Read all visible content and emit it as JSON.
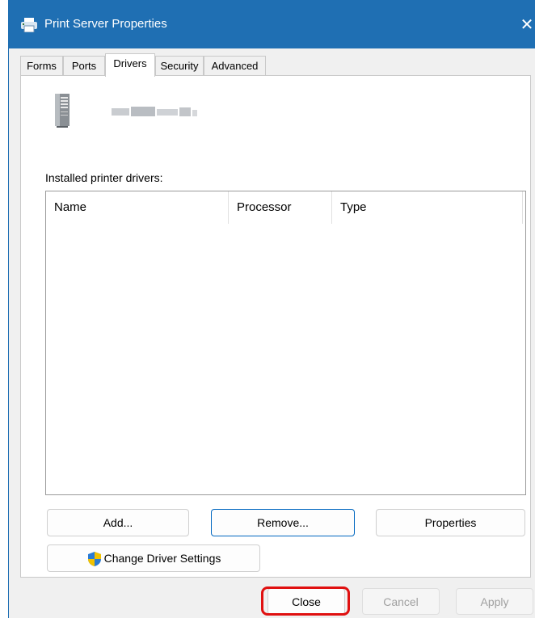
{
  "window": {
    "title": "Print Server Properties",
    "close_glyph": "✕",
    "accent_color": "#1f6fb3"
  },
  "tabs": [
    {
      "label": "Forms",
      "active": false
    },
    {
      "label": "Ports",
      "active": false
    },
    {
      "label": "Drivers",
      "active": true
    },
    {
      "label": "Security",
      "active": false
    },
    {
      "label": "Advanced",
      "active": false
    }
  ],
  "drivers_tab": {
    "server_icon": "server-tower-icon",
    "installed_label": "Installed printer drivers:",
    "columns": [
      "Name",
      "Processor",
      "Type"
    ],
    "rows": [],
    "buttons": {
      "add": "Add...",
      "remove": "Remove...",
      "properties": "Properties",
      "change_settings": "Change Driver Settings"
    }
  },
  "footer": {
    "close": "Close",
    "cancel": "Cancel",
    "apply": "Apply",
    "highlight_color": "#e01010"
  }
}
